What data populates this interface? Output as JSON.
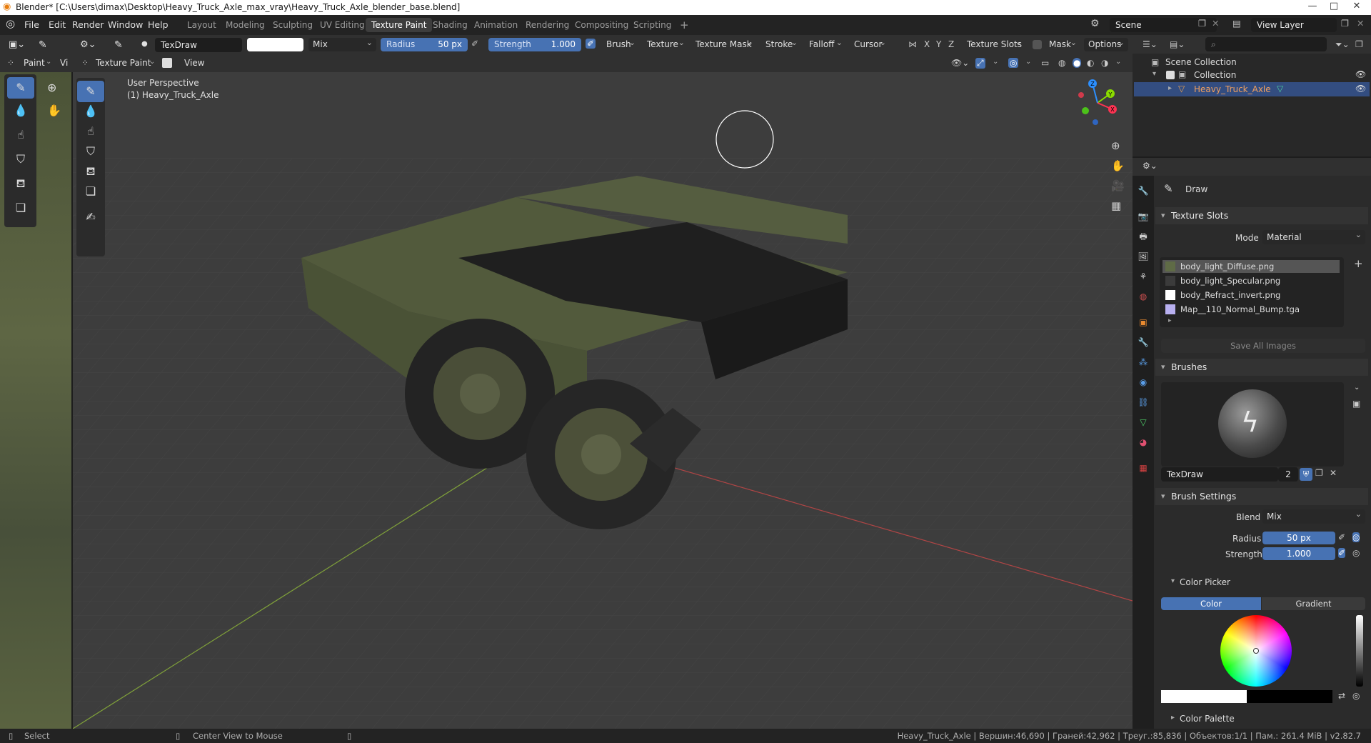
{
  "window": {
    "title": "Blender* [C:\\Users\\dimax\\Desktop\\Heavy_Truck_Axle_max_vray\\Heavy_Truck_Axle_blender_base.blend]",
    "minimize": "—",
    "maximize": "□",
    "close": "✕"
  },
  "menu": [
    "File",
    "Edit",
    "Render",
    "Window",
    "Help"
  ],
  "workspaces": [
    "Layout",
    "Modeling",
    "Sculpting",
    "UV Editing",
    "Texture Paint",
    "Shading",
    "Animation",
    "Rendering",
    "Compositing",
    "Scripting"
  ],
  "active_workspace": "Texture Paint",
  "add_workspace": "+",
  "scene": {
    "name": "Scene",
    "view_layer": "View Layer"
  },
  "tool_header": {
    "brush_name": "TexDraw",
    "blend": "Mix",
    "radius_label": "Radius",
    "radius_value": "50 px",
    "strength_label": "Strength",
    "strength_value": "1.000",
    "menus": [
      "Brush",
      "Texture",
      "Texture Mask",
      "Stroke",
      "Falloff",
      "Cursor"
    ],
    "axes": [
      "X",
      "Y",
      "Z"
    ],
    "texture_slots": "Texture Slots",
    "mask": "Mask",
    "options": "Options"
  },
  "mode_header": {
    "paint": "Paint",
    "view_cut": "Vi",
    "mode": "Texture Paint",
    "view": "View"
  },
  "viewport": {
    "perspective": "User Perspective",
    "object": "(1) Heavy_Truck_Axle"
  },
  "gizmo": {
    "x": "X",
    "y": "Y",
    "z": "Z"
  },
  "outliner": {
    "scene_collection": "Scene Collection",
    "collection": "Collection",
    "object": "Heavy_Truck_Axle"
  },
  "properties": {
    "tool": "Draw",
    "texture_slots_title": "Texture Slots",
    "mode_label": "Mode",
    "mode_value": "Material",
    "slots": [
      {
        "name": "body_light_Diffuse.png",
        "color": "#5f6b46",
        "selected": true
      },
      {
        "name": "body_light_Specular.png",
        "color": "#3b3b3b",
        "selected": false
      },
      {
        "name": "body_Refract_invert.png",
        "color": "#ffffff",
        "selected": false
      },
      {
        "name": "Map__110_Normal_Bump.tga",
        "color": "#b8b0f0",
        "selected": false
      }
    ],
    "save_all": "Save All Images",
    "brushes_title": "Brushes",
    "brush_name": "TexDraw",
    "brush_users": "2",
    "brush_settings_title": "Brush Settings",
    "blend_label": "Blend",
    "blend_value": "Mix",
    "radius_label": "Radius",
    "radius_value": "50 px",
    "strength_label": "Strength",
    "strength_value": "1.000",
    "color_picker_title": "Color Picker",
    "color_tab": "Color",
    "gradient_tab": "Gradient",
    "color_palette_title": "Color Palette"
  },
  "status": {
    "select": "Select",
    "center_view": "Center View to Mouse",
    "stats": "Heavy_Truck_Axle | Вершин:46,690 | Граней:42,962 | Треуг.:85,836 | Объектов:1/1 | Пам.: 261.4 MiB | v2.82.7"
  },
  "colors": {
    "accent": "#4772b3",
    "viewport_bg": "#3d3d3d",
    "truck_green": "#5b6142"
  }
}
